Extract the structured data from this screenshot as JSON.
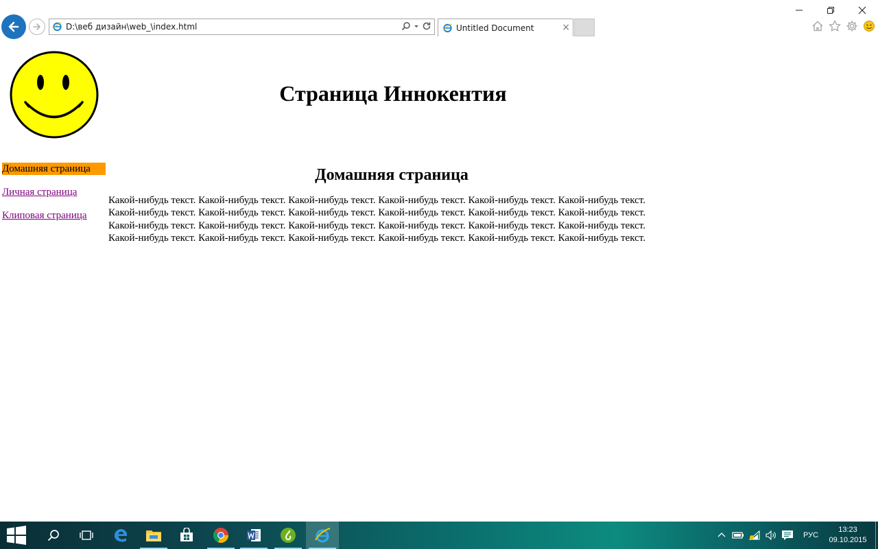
{
  "browser": {
    "address": "D:\\веб дизайн\\web_\\index.html",
    "tab_title": "Untitled Document",
    "tab_close": "×"
  },
  "page": {
    "site_title": "Страница Иннокентия",
    "nav": [
      {
        "label": "Домашняя страница",
        "active": true
      },
      {
        "label": "Личная страница",
        "active": false
      },
      {
        "label": "Клиповая страница",
        "active": false
      }
    ],
    "content_heading": "Домашняя страница",
    "content_text": "Какой-нибудь текст. Какой-нибудь текст. Какой-нибудь текст. Какой-нибудь текст. Какой-нибудь текст. Какой-нибудь текст. Какой-нибудь текст. Какой-нибудь текст. Какой-нибудь текст. Какой-нибудь текст. Какой-нибудь текст. Какой-нибудь текст. Какой-нибудь текст. Какой-нибудь текст. Какой-нибудь текст. Какой-нибудь текст. Какой-нибудь текст. Какой-нибудь текст. Какой-нибудь текст. Какой-нибудь текст. Какой-нибудь текст. Какой-нибудь текст. Какой-нибудь текст. Какой-нибудь текст."
  },
  "taskbar": {
    "apps": [
      "start-icon",
      "search-icon",
      "task-view-icon",
      "edge-icon",
      "file-explorer-icon",
      "store-icon",
      "chrome-icon",
      "word-icon",
      "dreamweaver-icon",
      "internet-explorer-icon"
    ],
    "language": "РУС",
    "time": "13:23",
    "date": "09.10.2015"
  },
  "colors": {
    "nav_active_bg": "#ff9900",
    "visited_link": "#800080",
    "smiley_fill": "#ffff00",
    "back_button": "#1e73be"
  }
}
